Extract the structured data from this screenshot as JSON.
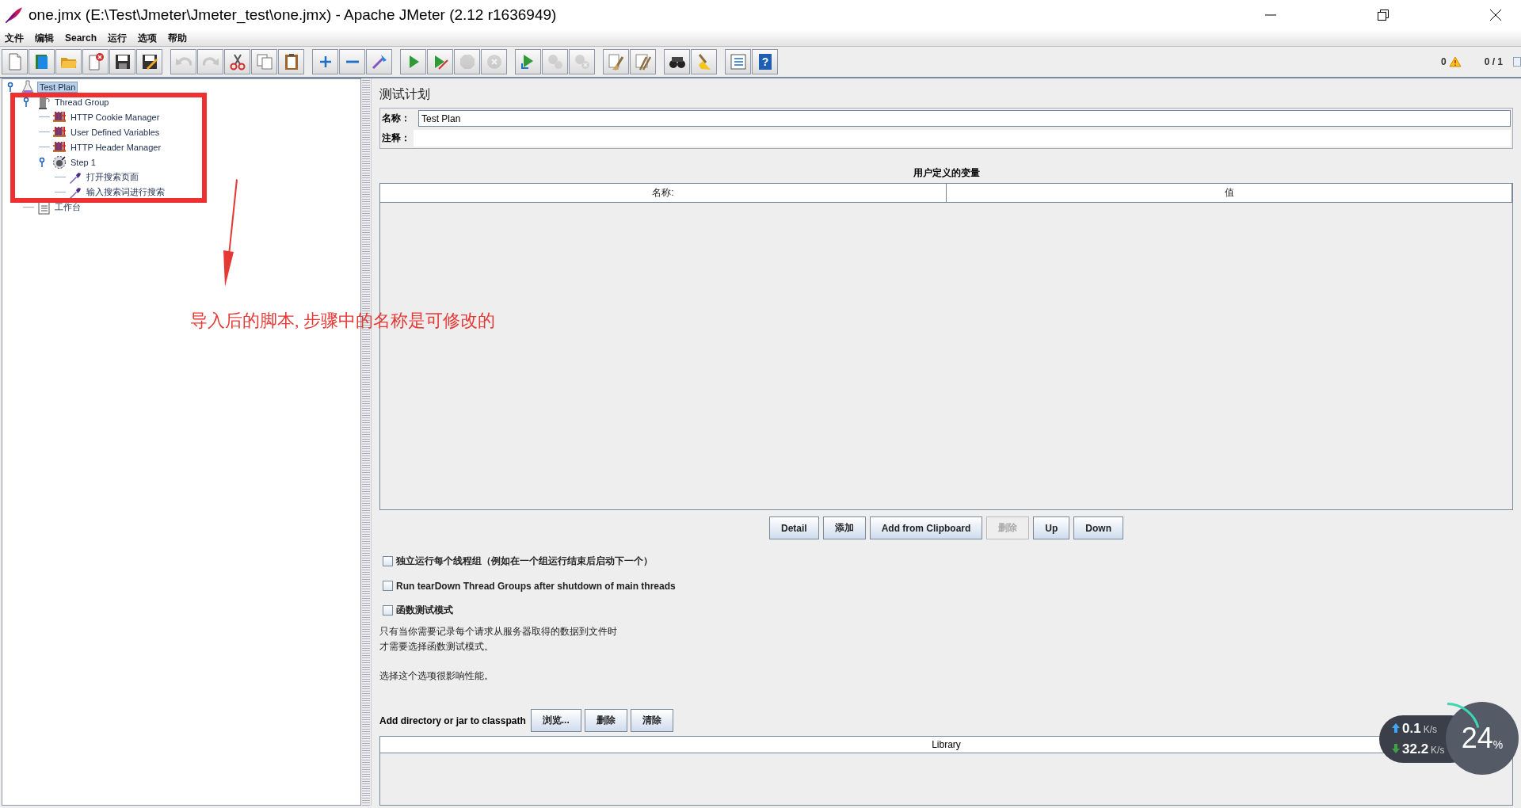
{
  "window": {
    "title": "one.jmx (E:\\Test\\Jmeter\\Jmeter_test\\one.jmx) - Apache JMeter (2.12 r1636949)"
  },
  "menu": [
    "文件",
    "编辑",
    "Search",
    "运行",
    "选项",
    "帮助"
  ],
  "toolbar": [
    [
      {
        "kind": "new",
        "disabled": false
      },
      {
        "kind": "templates",
        "disabled": false
      },
      {
        "kind": "open",
        "disabled": false
      },
      {
        "kind": "close",
        "disabled": false
      },
      {
        "kind": "save",
        "disabled": false
      },
      {
        "kind": "saveas",
        "disabled": false
      }
    ],
    [
      {
        "kind": "undo",
        "disabled": true
      },
      {
        "kind": "redo",
        "disabled": true
      },
      {
        "kind": "cut",
        "disabled": false
      },
      {
        "kind": "copy",
        "disabled": false
      },
      {
        "kind": "paste",
        "disabled": false
      }
    ],
    [
      {
        "kind": "expand",
        "disabled": false
      },
      {
        "kind": "collapse",
        "disabled": false
      },
      {
        "kind": "toggle",
        "disabled": false
      }
    ],
    [
      {
        "kind": "start",
        "disabled": false
      },
      {
        "kind": "startnopause",
        "disabled": false
      },
      {
        "kind": "stop",
        "disabled": true
      },
      {
        "kind": "shutdown",
        "disabled": true
      }
    ],
    [
      {
        "kind": "remotestart",
        "disabled": false
      },
      {
        "kind": "remotestop",
        "disabled": true
      },
      {
        "kind": "remoteshutdown",
        "disabled": true
      }
    ],
    [
      {
        "kind": "clear",
        "disabled": false
      },
      {
        "kind": "clearall",
        "disabled": false
      }
    ],
    [
      {
        "kind": "search",
        "disabled": false
      },
      {
        "kind": "reset",
        "disabled": false
      }
    ],
    [
      {
        "kind": "functions",
        "disabled": false
      },
      {
        "kind": "help",
        "disabled": false,
        "glyph": "?"
      }
    ]
  ],
  "status": {
    "errors": "0",
    "threads": "0 / 1"
  },
  "tree": [
    {
      "label": "Test Plan",
      "kind": "testplan",
      "selected": true,
      "expanded": true,
      "children": [
        {
          "label": "Thread Group",
          "kind": "threadgroup",
          "selected": false,
          "expanded": true,
          "children": [
            {
              "label": "HTTP Cookie Manager",
              "kind": "config",
              "selected": false
            },
            {
              "label": "User Defined Variables",
              "kind": "config",
              "selected": false
            },
            {
              "label": "HTTP Header Manager",
              "kind": "config",
              "selected": false
            },
            {
              "label": "Step 1",
              "kind": "controller",
              "selected": false,
              "expanded": true,
              "children": [
                {
                  "label": "打开搜索页面",
                  "kind": "sampler",
                  "selected": false
                },
                {
                  "label": "输入搜索词进行搜索",
                  "kind": "sampler",
                  "selected": false
                }
              ]
            }
          ]
        },
        {
          "label": "工作台",
          "kind": "workbench",
          "selected": false
        }
      ]
    }
  ],
  "panel": {
    "title": "测试计划",
    "fields": [
      {
        "label": "名称：",
        "value": "Test Plan"
      },
      {
        "label": "注释："
      }
    ],
    "variables": {
      "title": "用户定义的变量",
      "columns": [
        "名称:",
        "值"
      ]
    },
    "buttons": [
      {
        "label": "Detail",
        "disabled": false
      },
      {
        "label": "添加",
        "disabled": false
      },
      {
        "label": "Add from Clipboard",
        "disabled": false
      },
      {
        "label": "删除",
        "disabled": true
      },
      {
        "label": "Up",
        "disabled": false
      },
      {
        "label": "Down",
        "disabled": false
      }
    ],
    "options": [
      {
        "label": "独立运行每个线程组（例如在一个组运行结束后启动下一个）",
        "checked": false
      },
      {
        "label": "Run tearDown Thread Groups after shutdown of main threads",
        "checked": false
      },
      {
        "label": "函数测试模式",
        "checked": false
      }
    ],
    "notes": [
      [
        "只有当你需要记录每个请求从服务器取得的数据到文件时",
        "才需要选择函数测试模式。"
      ],
      [
        "选择这个选项很影响性能。"
      ]
    ],
    "classpath": {
      "label": "Add directory or jar to classpath",
      "buttons": [
        "浏览...",
        "删除",
        "清除"
      ],
      "column": "Library"
    }
  },
  "annotation": {
    "text": "导入后的脚本, 步骤中的名称是可修改的"
  },
  "speed_widget": {
    "upload": "0.1",
    "upload_unit": "K/s",
    "download": "32.2",
    "download_unit": "K/s",
    "cpu": "24",
    "cpu_unit": "%"
  }
}
